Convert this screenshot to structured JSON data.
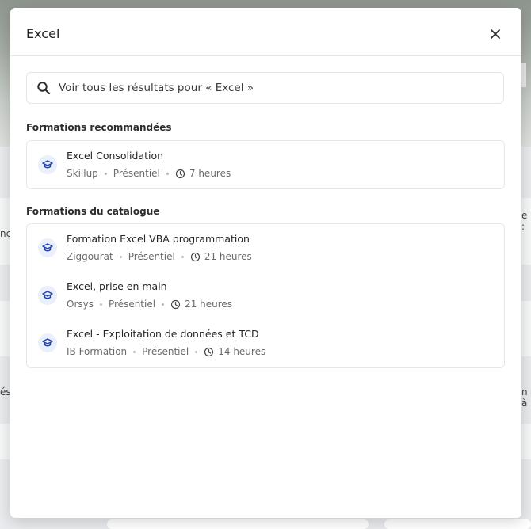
{
  "search": {
    "value": "Excel"
  },
  "see_all": {
    "label": "Voir tous les résultats pour « Excel »"
  },
  "sections": {
    "recommended": {
      "title": "Formations recommandées",
      "items": [
        {
          "title": "Excel Consolidation",
          "provider": "Skillup",
          "mode": "Présentiel",
          "duration": "7 heures"
        }
      ]
    },
    "catalog": {
      "title": "Formations du catalogue",
      "items": [
        {
          "title": "Formation Excel VBA programmation",
          "provider": "Ziggourat",
          "mode": "Présentiel",
          "duration": "21 heures"
        },
        {
          "title": "Excel, prise en main",
          "provider": "Orsys",
          "mode": "Présentiel",
          "duration": "21 heures"
        },
        {
          "title": "Excel - Exploitation de données et TCD",
          "provider": "IB Formation",
          "mode": "Présentiel",
          "duration": "14 heures"
        }
      ]
    }
  },
  "background": {
    "fragment_left_1": "nce",
    "fragment_left_2": "ése",
    "fragment_right_1": "e :",
    "fragment_right_2": "n à"
  },
  "colors": {
    "accent": "#1e40af",
    "accent_soft": "#e9f0fb"
  },
  "icons": {
    "search": "search-icon",
    "close": "close-icon",
    "course": "graduation-cap-icon",
    "duration": "clock-icon"
  }
}
